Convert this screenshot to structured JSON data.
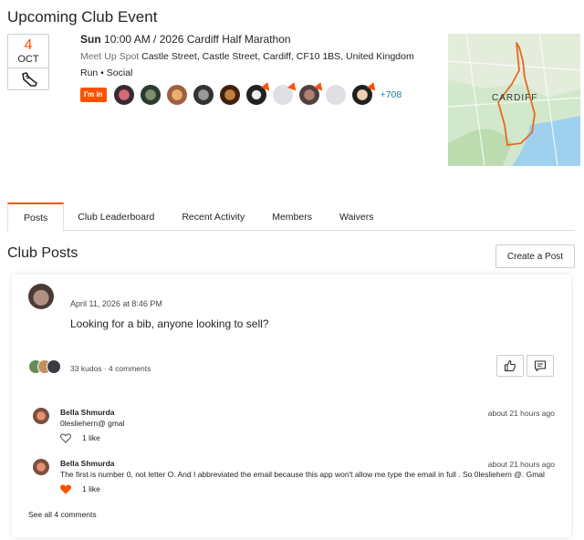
{
  "event": {
    "section_title": "Upcoming Club Event",
    "date_day": "4",
    "date_month": "OCT",
    "day_time": "Sun",
    "time_title": "10:00 AM / 2026 Cardiff Half Marathon",
    "meetup_label": "Meet Up Spot",
    "meetup_location": "Castle Street, Castle Street, Cardiff, CF10 1BS, United Kingdom",
    "tags": "Run • Social",
    "im_in_label": "I'm in",
    "more_count": "+708",
    "map_label": "CARDIFF",
    "colors": {
      "accent": "#fc5200",
      "link": "#1d7ba6"
    }
  },
  "tabs": [
    {
      "label": "Posts",
      "active": true
    },
    {
      "label": "Club Leaderboard"
    },
    {
      "label": "Recent Activity"
    },
    {
      "label": "Members"
    },
    {
      "label": "Waivers"
    }
  ],
  "posts_section": {
    "title": "Club Posts",
    "create_label": "Create a Post"
  },
  "post": {
    "date": "April 11, 2026 at 8:46 PM",
    "text": "Looking for a bib, anyone looking to sell?",
    "kudos_summary": "33 kudos · 4 comments",
    "comments": [
      {
        "author": "Bella Shmurda",
        "text": "0lesliehern@ gmal",
        "time": "about 21 hours ago",
        "likes": "1 like",
        "liked": false
      },
      {
        "author": "Bella Shmurda",
        "text": "The first is number 0, not letter O. And I abbreviated the email because this app won't allow me type the email in full . So 0lesliehern @. Gmal",
        "time": "about 21 hours ago",
        "likes": "1 like",
        "liked": true
      }
    ],
    "see_all": "See all 4 comments"
  }
}
